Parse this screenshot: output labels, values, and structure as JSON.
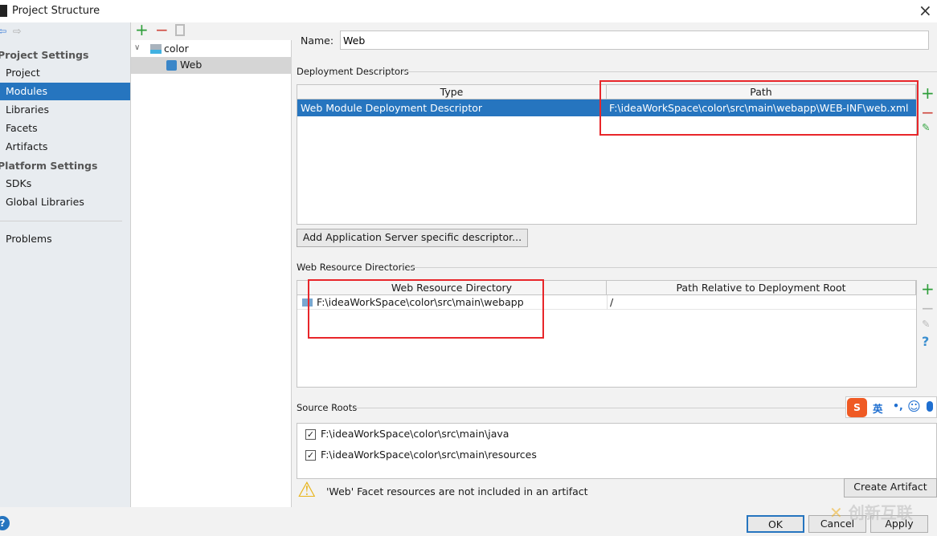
{
  "window": {
    "title": "Project Structure",
    "close": "×"
  },
  "sidebar": {
    "project_settings": "Project Settings",
    "items": [
      "Project",
      "Modules",
      "Libraries",
      "Facets",
      "Artifacts"
    ],
    "platform_settings": "Platform Settings",
    "platform_items": [
      "SDKs",
      "Global Libraries"
    ],
    "problems": "Problems"
  },
  "tree": {
    "root": "color",
    "child": "Web"
  },
  "main": {
    "name_label": "Name:",
    "name_value": "Web",
    "deployment": {
      "title": "Deployment Descriptors",
      "columns": [
        "Type",
        "Path"
      ],
      "rows": [
        [
          "Web Module Deployment Descriptor",
          "F:\\ideaWorkSpace\\color\\src\\main\\webapp\\WEB-INF\\web.xml"
        ]
      ],
      "add_button": "Add Application Server specific descriptor..."
    },
    "web_resources": {
      "title": "Web Resource Directories",
      "columns": [
        "Web Resource Directory",
        "Path Relative to Deployment Root"
      ],
      "rows": [
        [
          "F:\\ideaWorkSpace\\color\\src\\main\\webapp",
          "/"
        ]
      ]
    },
    "source_roots": {
      "title": "Source Roots",
      "items": [
        "F:\\ideaWorkSpace\\color\\src\\main\\java",
        "F:\\ideaWorkSpace\\color\\src\\main\\resources"
      ]
    },
    "warning": "'Web' Facet resources are not included in an artifact",
    "create_artifact": "Create Artifact"
  },
  "footer": {
    "ok": "OK",
    "cancel": "Cancel",
    "apply": "Apply",
    "help": "?"
  },
  "ime": {
    "lang": "英",
    "punct": "•,"
  },
  "watermark": "创新互联",
  "colors": {
    "selection": "#2675bf",
    "highlight": "#e8262a",
    "add": "#2e9e3a",
    "remove": "#d04a40"
  }
}
